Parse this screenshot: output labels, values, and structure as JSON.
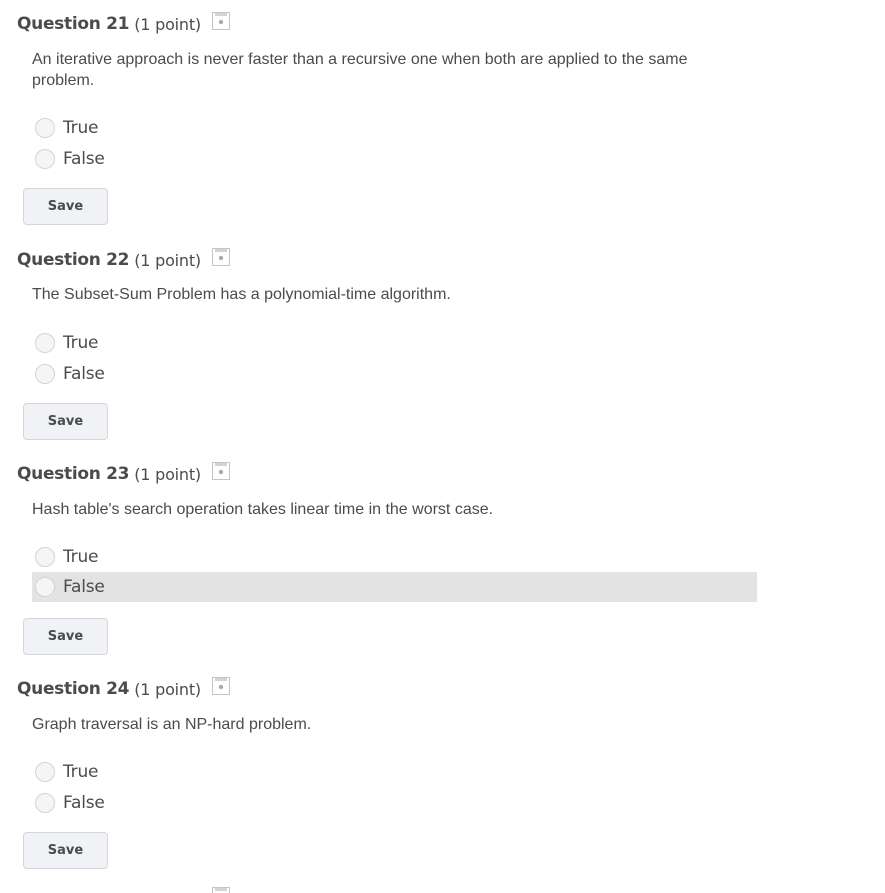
{
  "questions": [
    {
      "title": "Question 21",
      "points": "(1 point)",
      "text": "An iterative approach is never faster than a recursive one when both are applied to the same problem.",
      "options": [
        {
          "label": "True",
          "highlighted": false
        },
        {
          "label": "False",
          "highlighted": false
        }
      ],
      "save_label": "Save"
    },
    {
      "title": "Question 22",
      "points": "(1 point)",
      "text": "The Subset-Sum Problem has a polynomial-time algorithm.",
      "options": [
        {
          "label": "True",
          "highlighted": false
        },
        {
          "label": "False",
          "highlighted": false
        }
      ],
      "save_label": "Save"
    },
    {
      "title": "Question 23",
      "points": "(1 point)",
      "text": "Hash table's search operation takes linear time in the worst case.",
      "options": [
        {
          "label": "True",
          "highlighted": false
        },
        {
          "label": "False",
          "highlighted": true
        }
      ],
      "save_label": "Save"
    },
    {
      "title": "Question 24",
      "points": "(1 point)",
      "text": "Graph traversal is an NP-hard problem.",
      "options": [
        {
          "label": "True",
          "highlighted": false
        },
        {
          "label": "False",
          "highlighted": false
        }
      ],
      "save_label": "Save"
    }
  ],
  "icons": {
    "question_status": "save-status-icon"
  },
  "colors": {
    "text": "#494c4e",
    "highlight": "#e3e3e4",
    "button_bg": "#f1f2f5",
    "button_border": "#d3d7db",
    "radio_border": "#d3d4d6"
  }
}
